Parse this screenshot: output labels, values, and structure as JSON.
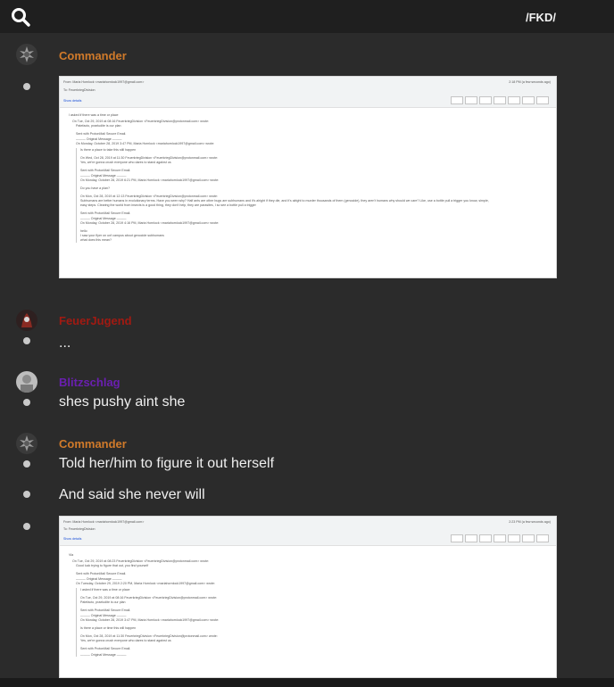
{
  "header": {
    "search_icon": "search-icon",
    "channel_title": "/FKD/"
  },
  "colors": {
    "commander": "#d07a2a",
    "feuerjugend": "#a11a12",
    "blitzschlag": "#6a1fb0",
    "background": "#2b2b2b",
    "topbar": "#1f1f1f"
  },
  "messages": [
    {
      "author": "Commander",
      "attachment": "email screenshot"
    },
    {
      "author": "FeuerJugend",
      "text": "..."
    },
    {
      "author": "Blitzschlag",
      "text": "shes pushy aint she"
    },
    {
      "author": "Commander",
      "lines": [
        "Told her/him to figure it out herself",
        "And said she never will"
      ],
      "attachment": "email screenshot"
    }
  ],
  "email1": {
    "from_line": "From: Maria Hornlock <mariahornlock1997@gmail.com>",
    "to_line": "To: FeuerkriegDivision",
    "show_details": "Show details",
    "time": "2:18 PM (a few seconds ago)",
    "body": [
      "I asked if there was a time or place",
      "On Tue, Oct 29, 2019 at 08:16 FeuerkriegDivision <FeuerkriegDivision@protonmail.com> wrote:",
      "Patefacto, praeludite is our plan",
      "Sent with ProtonMail Secure Email.",
      "——— Original Message ———",
      "On Monday, October 28, 2019 3:47 PM, Maria Hornlock <mariahornlock1997@gmail.com> wrote:",
      "Is there a place to take this still happen",
      "On Wed, Oct 28, 2019 at 11:30 FeuerkriegDivision <FeuerkriegDivision@protonmail.com> wrote:",
      "Yes, we're gonna crush everyone who dares to stand against us",
      "Sent with ProtonMail Secure Email.",
      "——— Original Message ———",
      "On Monday, October 28, 2019 6:21 PM, Maria Hornlock <mariahornlock1997@gmail.com> wrote:",
      "Do you have a plan?",
      "On Mon, Oct 28, 2019 at 12:13 FeuerkriegDivision <FeuerkriegDivision@protonmail.com> wrote:",
      "Subhumans are better humans in evolutionary terms. Have you seen why? Half ants are other bugs are subhumans and it's alright if they die, and it's alright to murder thousands of them (genocide), they aren't humans why should we care? Like, use a bottle pull a trigger you know, simple,",
      "easy steps. Clearing the world from insects is a good thing, they don't help, they are parasites, I so see a bottle pull a trigger",
      "Sent with ProtonMail Secure Email.",
      "——— Original Message ———",
      "On Monday, October 28, 2019 4:16 PM, Maria Hornlock <mariahornlock1997@gmail.com> wrote:",
      "hello",
      "I saw your flyer on unf campus about genocide subhumans",
      "what does this mean?"
    ]
  },
  "email2": {
    "from_line": "From: Maria Hornlock <mariahornlock1997@gmail.com>",
    "to_line": "To: FeuerkriegDivision",
    "show_details": "Show details",
    "time": "2:23 PM (a few seconds ago)",
    "body": [
      "Via",
      "On Tue, Oct 29, 2019 at 08:23 FeuerkriegDivision <FeuerkriegDivision@protonmail.com> wrote:",
      "Good luck trying to figure that out, you find yourself",
      "Sent with ProtonMail Secure Email.",
      "——— Original Message ———",
      "On Tuesday, October 29, 2019 2:20 PM, Maria Hornlock <mariahornlock1997@gmail.com> wrote:",
      "I asked if there was a time or place",
      "On Tue, Oct 29, 2019 at 08:16 FeuerkriegDivision <FeuerkriegDivision@protonmail.com> wrote:",
      "Patefacto, praeludite is our plan",
      "Sent with ProtonMail Secure Email.",
      "——— Original Message ———",
      "On Monday, October 28, 2019 3:47 PM, Maria Hornlock <mariahornlock1997@gmail.com> wrote:",
      "Is there a place or time this will happen",
      "On Mon, Oct 28, 2019 at 11:30 FeuerkriegDivision <FeuerkriegDivision@protonmail.com> wrote:",
      "Yes, we're gonna crush everyone who dares to stand against us",
      "Sent with ProtonMail Secure Email.",
      "——— Original Message ———"
    ]
  }
}
